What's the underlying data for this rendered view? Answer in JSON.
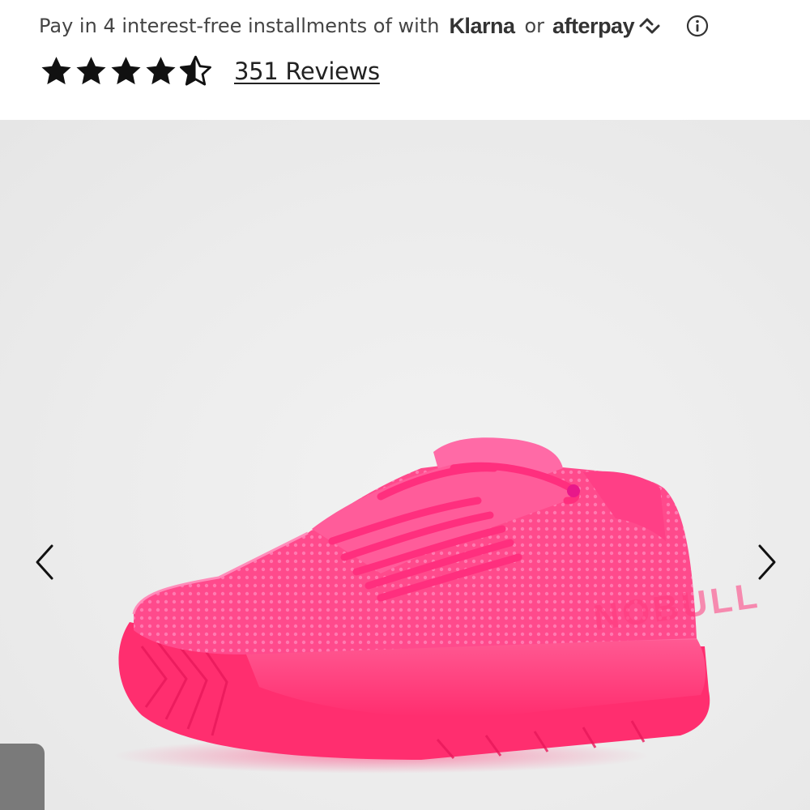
{
  "payment": {
    "text": "Pay in 4 interest-free installments of with",
    "klarna": "Klarna",
    "or_text": "or",
    "afterpay": "afterpay",
    "info_icon": "info-circle-icon"
  },
  "rating": {
    "value": 4.5,
    "max": 5,
    "reviews_label": "351 Reviews"
  },
  "gallery": {
    "prev_icon": "chevron-left-icon",
    "next_icon": "chevron-right-icon",
    "product_brand_mark": "NOBULL",
    "product_color": "#ff3f86",
    "background_color": "#ececec"
  }
}
